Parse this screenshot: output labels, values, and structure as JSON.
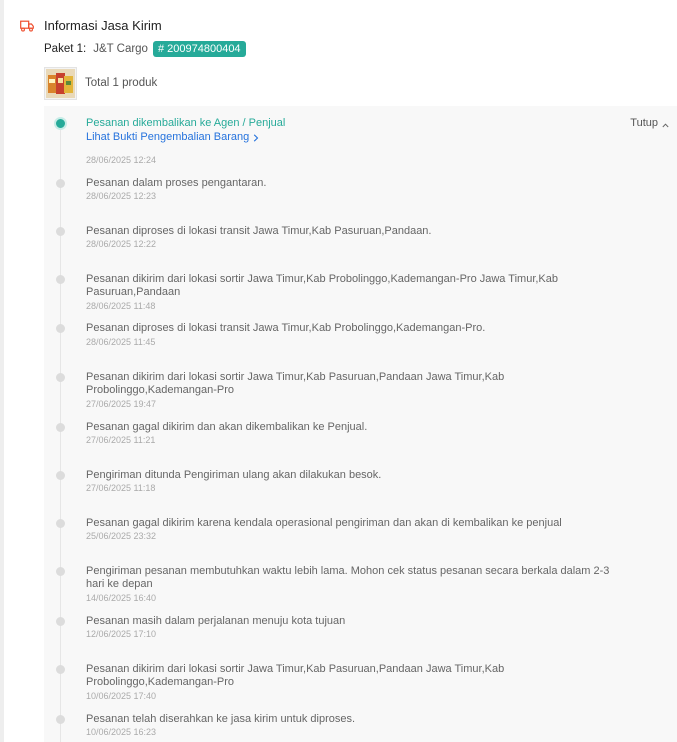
{
  "header": {
    "title": "Informasi Jasa Kirim",
    "icon": "truck-icon"
  },
  "package": {
    "label": "Paket 1:",
    "courier": "J&T Cargo",
    "tracking_number": "# 200974800404"
  },
  "product": {
    "total_text": "Total 1 produk"
  },
  "tracking": {
    "collapse_label": "Tutup",
    "proof_link": "Lihat Bukti Pengembalian Barang",
    "events": [
      {
        "text": "Pesanan dikembalikan ke Agen / Penjual",
        "time": "28/06/2025 12:24",
        "active": true
      },
      {
        "text": "Pesanan dalam proses pengantaran.",
        "time": "28/06/2025 12:23"
      },
      {
        "text": "Pesanan diproses di lokasi transit Jawa Timur,Kab Pasuruan,Pandaan.",
        "time": "28/06/2025 12:22"
      },
      {
        "text": "Pesanan dikirim dari lokasi sortir Jawa Timur,Kab Probolinggo,Kademangan-Pro Jawa Timur,Kab Pasuruan,Pandaan",
        "time": "28/06/2025 11:48"
      },
      {
        "text": "Pesanan diproses di lokasi transit Jawa Timur,Kab Probolinggo,Kademangan-Pro.",
        "time": "28/06/2025 11:45"
      },
      {
        "text": "Pesanan dikirim dari lokasi sortir Jawa Timur,Kab Pasuruan,Pandaan Jawa Timur,Kab Probolinggo,Kademangan-Pro",
        "time": "27/06/2025 19:47"
      },
      {
        "text": "Pesanan gagal dikirim dan akan dikembalikan ke Penjual.",
        "time": "27/06/2025 11:21"
      },
      {
        "text": "Pengiriman ditunda Pengiriman ulang akan dilakukan besok.",
        "time": "27/06/2025 11:18"
      },
      {
        "text": "Pesanan gagal dikirim karena kendala operasional pengiriman dan akan di kembalikan ke penjual",
        "time": "25/06/2025 23:32"
      },
      {
        "text": "Pengiriman pesanan membutuhkan waktu lebih lama. Mohon cek status pesanan secara berkala dalam 2-3 hari ke depan",
        "time": "14/06/2025 16:40"
      },
      {
        "text": "Pesanan masih dalam perjalanan menuju kota tujuan",
        "time": "12/06/2025 17:10"
      },
      {
        "text": "Pesanan dikirim dari lokasi sortir Jawa Timur,Kab Pasuruan,Pandaan Jawa Timur,Kab Probolinggo,Kademangan-Pro",
        "time": "10/06/2025 17:40"
      },
      {
        "text": "Pesanan telah diserahkan ke jasa kirim untuk diproses.",
        "time": "10/06/2025 16:23"
      }
    ]
  },
  "colors": {
    "accent": "#26aa99",
    "link": "#2673dd",
    "header_icon": "#ee4d2d"
  }
}
